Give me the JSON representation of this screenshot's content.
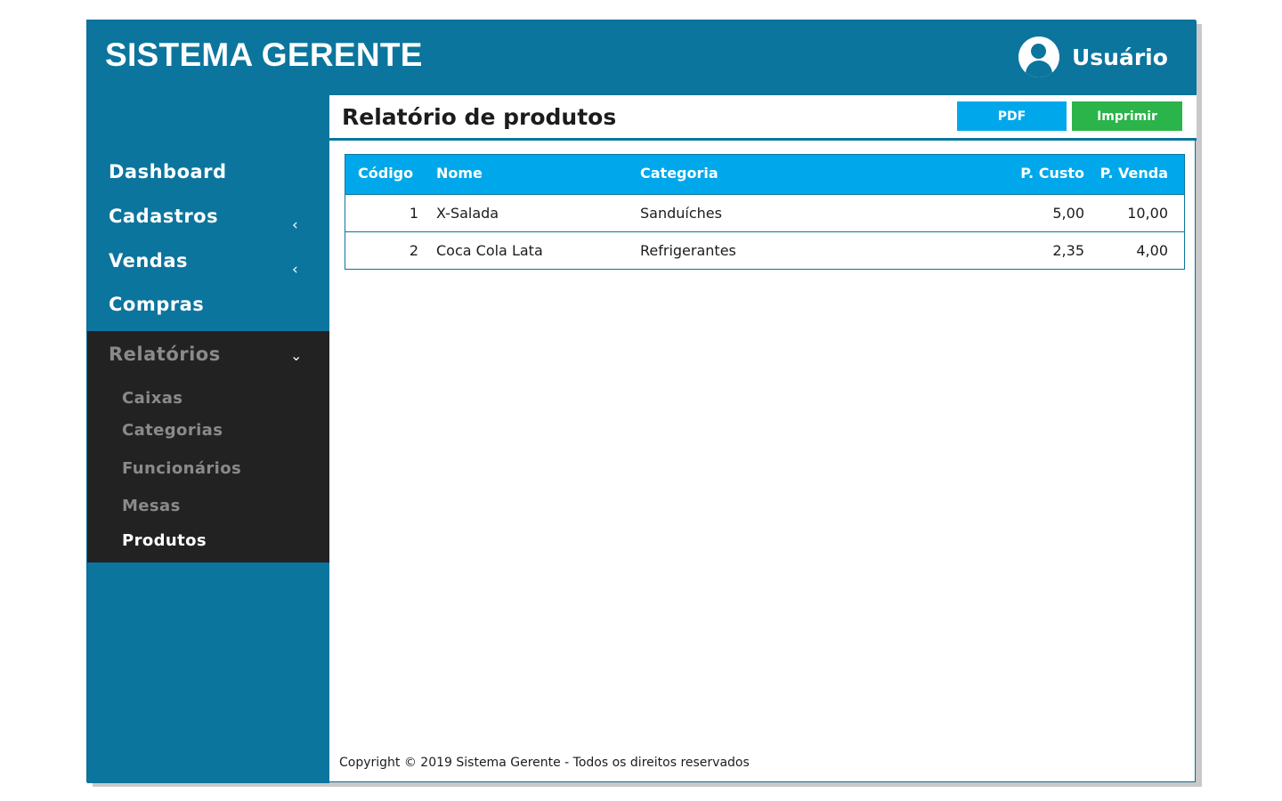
{
  "header": {
    "brand": "SISTEMA GERENTE",
    "user_name": "Usuário"
  },
  "sidebar": {
    "items": [
      {
        "label": "Dashboard"
      },
      {
        "label": "Cadastros",
        "chevron": "‹"
      },
      {
        "label": "Vendas",
        "chevron": "‹"
      },
      {
        "label": "Compras"
      }
    ],
    "reports": {
      "label": "Relatórios",
      "chevron": "⌄",
      "items": [
        {
          "label": "Caixas"
        },
        {
          "label": "Categorias"
        },
        {
          "label": "Funcionários"
        },
        {
          "label": "Mesas"
        },
        {
          "label": "Produtos",
          "active": true
        }
      ]
    }
  },
  "page": {
    "title": "Relatório de produtos",
    "pdf_label": "PDF",
    "print_label": "Imprimir"
  },
  "table": {
    "columns": [
      "Código",
      "Nome",
      "Categoria",
      "P. Custo",
      "P. Venda"
    ],
    "rows": [
      [
        "1",
        "X-Salada",
        "Sanduíches",
        "5,00",
        "10,00"
      ],
      [
        "2",
        "Coca Cola Lata",
        "Refrigerantes",
        "2,35",
        "4,00"
      ]
    ]
  },
  "footer": {
    "text": "Copyright © 2019 Sistema Gerente - Todos os direitos reservados"
  },
  "colors": {
    "primary": "#0b759e",
    "header_accent": "#00a8eb",
    "print_button": "#2bb44a",
    "submenu_bg": "#232223"
  },
  "icons": {
    "user": "user-avatar-icon"
  }
}
